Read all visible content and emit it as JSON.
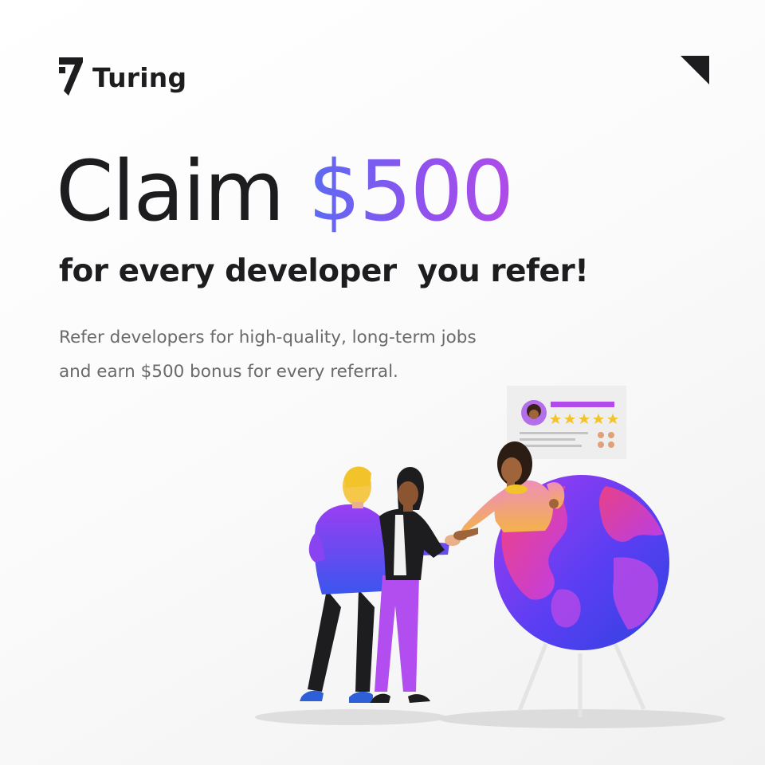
{
  "brand": {
    "name": "Turing",
    "logo_icon": "turing-logo-mark",
    "corner_icon": "corner-triangle-icon"
  },
  "headline": {
    "prefix": "Claim ",
    "amount": "$500"
  },
  "subheadline": "for every developer  you refer!",
  "body": {
    "line1": "Refer developers for high-quality, long-term jobs",
    "line2": "and earn $500 bonus for every referral."
  },
  "illustration": {
    "description_icon": "referral-handshake-globe-illustration",
    "rating_stars": 5
  },
  "colors": {
    "text_dark": "#1d1d1f",
    "text_muted": "#6a6a6a",
    "accent_gradient_start": "#5b6bf3",
    "accent_gradient_end": "#b14be9",
    "star": "#f3c32c"
  }
}
